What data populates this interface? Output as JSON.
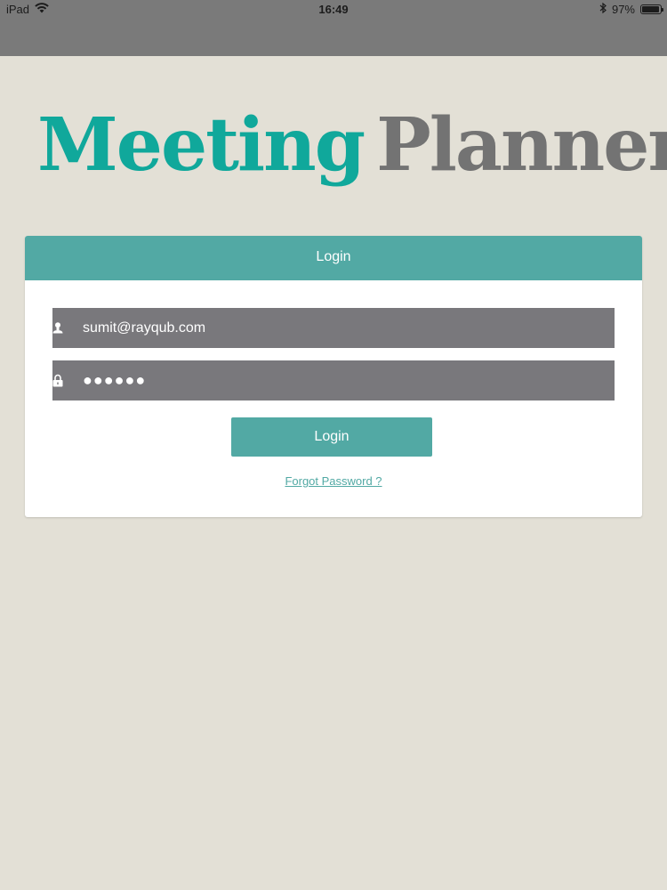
{
  "status_bar": {
    "device": "iPad",
    "time": "16:49",
    "battery_percent": "97%",
    "battery_level": 0.97,
    "icons": [
      "wifi-icon",
      "bluetooth-icon",
      "battery-icon"
    ]
  },
  "logo": {
    "word1": "Meeting",
    "word2": "Planner",
    "colors": {
      "word1": "#10a89b",
      "word2": "#737373"
    }
  },
  "login_card": {
    "header": "Login",
    "username": {
      "value": "sumit@rayqub.com",
      "icon": "user-icon"
    },
    "password": {
      "value": "●●●●●●",
      "icon": "lock-icon"
    },
    "login_button": "Login",
    "forgot_link": "Forgot Password ?"
  },
  "colors": {
    "accent": "#52a9a4",
    "field_bg": "#79787c",
    "page_bg": "#e3e0d6",
    "status_bar_bg": "#7a7a7a"
  }
}
